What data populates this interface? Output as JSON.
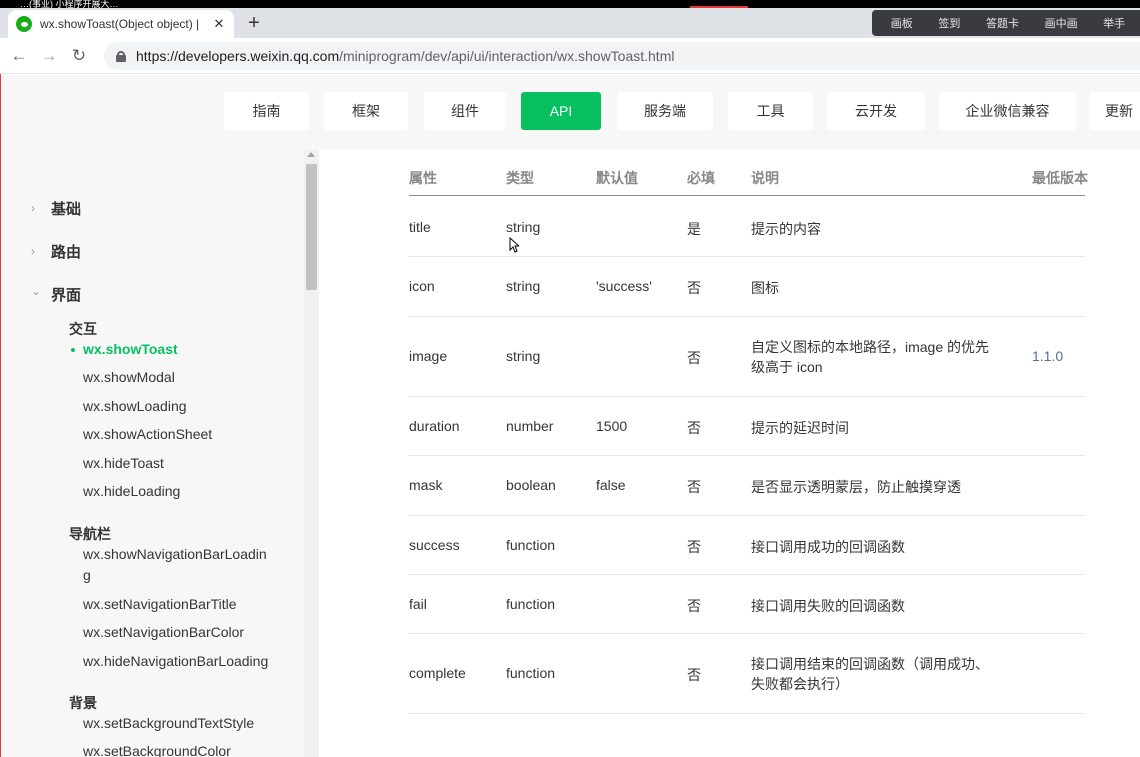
{
  "window": {
    "top_strip_text": "…(事业) 小程序开展大… ",
    "tab_title": "wx.showToast(Object object) |",
    "tab_close": "✕",
    "new_tab": "+"
  },
  "overlay_toolbar": [
    "画板",
    "签到",
    "答题卡",
    "画中画",
    "举手"
  ],
  "address": {
    "host": "https://developers.weixin.qq.com",
    "path": "/miniprogram/dev/api/ui/interaction/wx.showToast.html"
  },
  "topnav": [
    {
      "label": "指南"
    },
    {
      "label": "框架"
    },
    {
      "label": "组件"
    },
    {
      "label": "API",
      "active": true
    },
    {
      "label": "服务端"
    },
    {
      "label": "工具"
    },
    {
      "label": "云开发"
    },
    {
      "label": "企业微信兼容"
    },
    {
      "label": "更新"
    }
  ],
  "sidebar": {
    "groups": [
      {
        "label": "基础",
        "expanded": false
      },
      {
        "label": "路由",
        "expanded": false
      },
      {
        "label": "界面",
        "expanded": true
      }
    ],
    "categories": [
      {
        "label": "交互",
        "items": [
          "wx.showToast",
          "wx.showModal",
          "wx.showLoading",
          "wx.showActionSheet",
          "wx.hideToast",
          "wx.hideLoading"
        ],
        "active_index": 0
      },
      {
        "label": "导航栏",
        "items": [
          "wx.showNavigationBarLoading",
          "wx.setNavigationBarTitle",
          "wx.setNavigationBarColor",
          "wx.hideNavigationBarLoading"
        ]
      },
      {
        "label": "背景",
        "items": [
          "wx.setBackgroundTextStyle",
          "wx.setBackgroundColor"
        ]
      }
    ]
  },
  "table": {
    "headers": [
      "属性",
      "类型",
      "默认值",
      "必填",
      "说明",
      "最低版本"
    ],
    "rows": [
      {
        "name": "title",
        "type": "string",
        "default": "",
        "required": "是",
        "desc": "提示的内容",
        "version": ""
      },
      {
        "name": "icon",
        "type": "string",
        "default": "'success'",
        "required": "否",
        "desc": "图标",
        "version": ""
      },
      {
        "name": "image",
        "type": "string",
        "default": "",
        "required": "否",
        "desc": "自定义图标的本地路径，image 的优先级高于 icon",
        "version": "1.1.0"
      },
      {
        "name": "duration",
        "type": "number",
        "default": "1500",
        "required": "否",
        "desc": "提示的延迟时间",
        "version": ""
      },
      {
        "name": "mask",
        "type": "boolean",
        "default": "false",
        "required": "否",
        "desc": "是否显示透明蒙层，防止触摸穿透",
        "version": ""
      },
      {
        "name": "success",
        "type": "function",
        "default": "",
        "required": "否",
        "desc": "接口调用成功的回调函数",
        "version": ""
      },
      {
        "name": "fail",
        "type": "function",
        "default": "",
        "required": "否",
        "desc": "接口调用失败的回调函数",
        "version": ""
      },
      {
        "name": "complete",
        "type": "function",
        "default": "",
        "required": "否",
        "desc": "接口调用结束的回调函数（调用成功、失败都会执行）",
        "version": ""
      }
    ]
  },
  "colors": {
    "accent": "#07c160",
    "link": "#576b95",
    "text": "#353535",
    "muted": "#888888",
    "nav_bg": "#f7f7f7"
  }
}
